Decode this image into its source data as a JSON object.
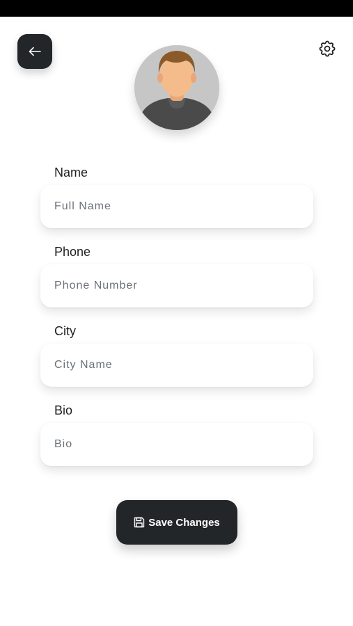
{
  "header": {
    "back_icon": "arrow-left-icon",
    "settings_icon": "gear-icon"
  },
  "avatar": {
    "icon": "user-avatar"
  },
  "form": {
    "fields": [
      {
        "label": "Name",
        "placeholder": "Full Name",
        "value": ""
      },
      {
        "label": "Phone",
        "placeholder": "Phone Number",
        "value": ""
      },
      {
        "label": "City",
        "placeholder": "City Name",
        "value": ""
      },
      {
        "label": "Bio",
        "placeholder": "Bio",
        "value": ""
      }
    ]
  },
  "save_button": {
    "label": "Save Changes",
    "icon": "floppy-disk-icon"
  },
  "colors": {
    "dark": "#222628",
    "background": "#ffffff",
    "placeholder": "#6b7177"
  }
}
